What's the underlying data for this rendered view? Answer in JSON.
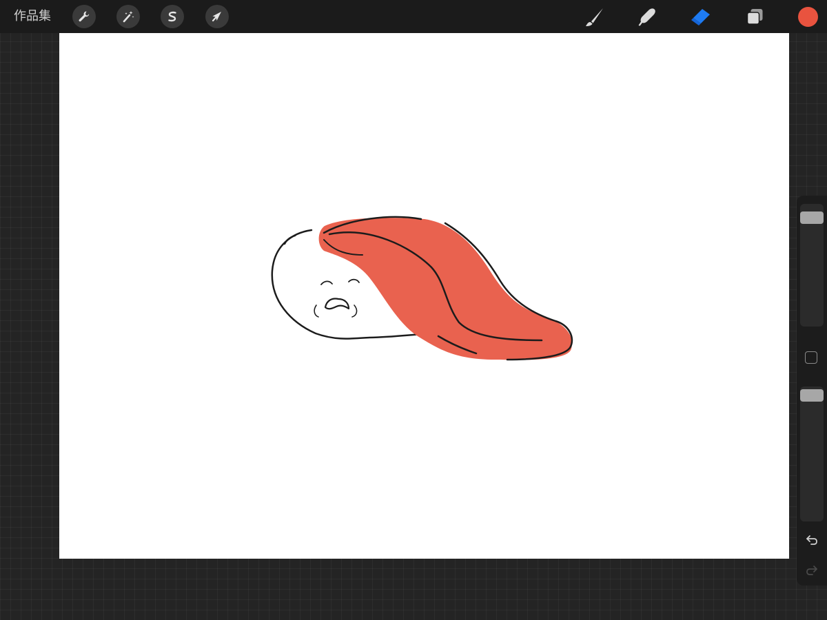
{
  "toolbar": {
    "gallery_label": "作品集",
    "left_tools": [
      {
        "name": "actions",
        "icon": "wrench-icon"
      },
      {
        "name": "adjustments",
        "icon": "magic-wand-icon"
      },
      {
        "name": "selection",
        "icon": "selection-s-icon"
      },
      {
        "name": "transform",
        "icon": "arrow-cursor-icon"
      }
    ],
    "right_tools": [
      {
        "name": "brush",
        "icon": "brush-icon",
        "active": false
      },
      {
        "name": "smudge",
        "icon": "smudge-finger-icon",
        "active": false
      },
      {
        "name": "eraser",
        "icon": "eraser-icon",
        "active": true
      },
      {
        "name": "layers",
        "icon": "layers-icon",
        "active": false
      }
    ],
    "current_color": "#e9533f",
    "active_tool_color": "#1e7bf2"
  },
  "sidebar": {
    "brush_size_level": 0.07,
    "opacity_level": 0.02,
    "icons": [
      "modify-square-icon",
      "undo-icon",
      "redo-icon"
    ]
  },
  "canvas": {
    "background": "#ffffff",
    "artwork": "sushi-character-illustration"
  }
}
